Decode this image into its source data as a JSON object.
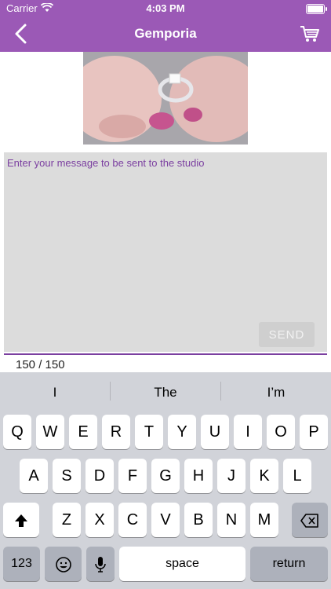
{
  "status_bar": {
    "carrier": "Carrier",
    "time": "4:03 PM"
  },
  "header": {
    "title": "Gemporia",
    "back_icon": "chevron-left-icon",
    "cart_icon": "cart-icon"
  },
  "message": {
    "placeholder": "Enter your message to be sent to the studio",
    "value": "",
    "send_label": "SEND",
    "counter": "150 / 150"
  },
  "keyboard": {
    "suggestions": [
      "I",
      "The",
      "I’m"
    ],
    "row1": [
      "Q",
      "W",
      "E",
      "R",
      "T",
      "Y",
      "U",
      "I",
      "O",
      "P"
    ],
    "row2": [
      "A",
      "S",
      "D",
      "F",
      "G",
      "H",
      "J",
      "K",
      "L"
    ],
    "row3": [
      "Z",
      "X",
      "C",
      "V",
      "B",
      "N",
      "M"
    ],
    "numbers_label": "123",
    "space_label": "space",
    "return_label": "return"
  },
  "colors": {
    "header": "#9b59b6",
    "accent": "#7b3fa0",
    "keyboard_bg": "#d1d3d9"
  }
}
